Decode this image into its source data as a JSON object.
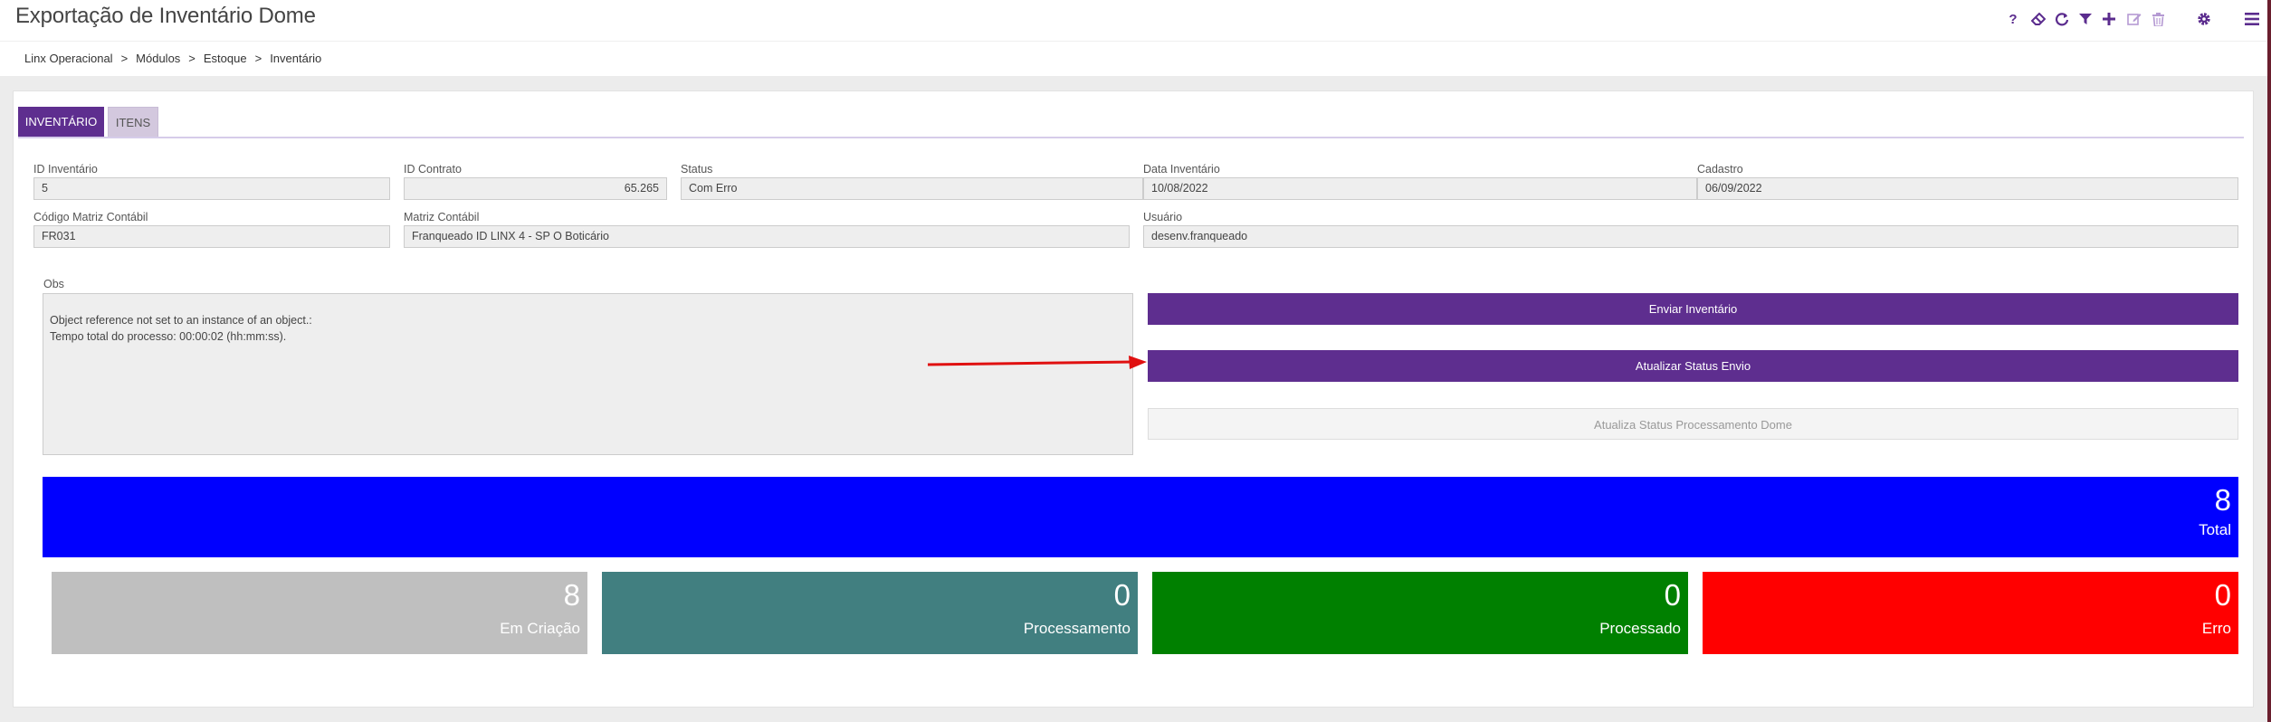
{
  "header": {
    "title": "Exportação de Inventário Dome"
  },
  "toolbar": {
    "icons": [
      "help-icon",
      "eraser-icon",
      "refresh-icon",
      "filter-icon",
      "add-icon",
      "edit-icon",
      "delete-icon",
      "settings-icon",
      "menu-icon"
    ],
    "help_glyph": "?",
    "accent": "#5b2c8e"
  },
  "breadcrumb": {
    "items": [
      "Linx Operacional",
      "Módulos",
      "Estoque",
      "Inventário"
    ],
    "separator": ">"
  },
  "tabs": [
    {
      "label": "INVENTÁRIO",
      "active": true
    },
    {
      "label": "ITENS",
      "active": false
    }
  ],
  "fields": {
    "id_inventario": {
      "label": "ID Inventário",
      "value": "5"
    },
    "id_contrato": {
      "label": "ID Contrato",
      "value": "65.265"
    },
    "status": {
      "label": "Status",
      "value": "Com Erro"
    },
    "data_inventario": {
      "label": "Data Inventário",
      "value": "10/08/2022"
    },
    "cadastro": {
      "label": "Cadastro",
      "value": "06/09/2022"
    },
    "codigo_matriz": {
      "label": "Código Matriz Contábil",
      "value": "FR031"
    },
    "matriz_contabil": {
      "label": "Matriz Contábil",
      "value": "Franqueado ID LINX 4 - SP O Boticário"
    },
    "usuario": {
      "label": "Usuário",
      "value": "desenv.franqueado"
    }
  },
  "obs": {
    "label": "Obs",
    "lines": [
      "Object reference not set to an instance of an object.:",
      "Tempo total do processo: 00:00:02 (hh:mm:ss)."
    ]
  },
  "actions": {
    "enviar": "Enviar Inventário",
    "atualizar_status": "Atualizar Status Envio",
    "atualiza_processamento": "Atualiza Status Processamento Dome"
  },
  "stats": {
    "total": {
      "value": "8",
      "label": "Total",
      "color": "#0000ff"
    },
    "em_criacao": {
      "value": "8",
      "label": "Em Criação",
      "color": "#bfbfbf"
    },
    "processamento": {
      "value": "0",
      "label": "Processamento",
      "color": "#417f80"
    },
    "processado": {
      "value": "0",
      "label": "Processado",
      "color": "#008000"
    },
    "erro": {
      "value": "0",
      "label": "Erro",
      "color": "#ff0000"
    }
  },
  "annotation": {
    "arrow_color": "#e01010"
  }
}
